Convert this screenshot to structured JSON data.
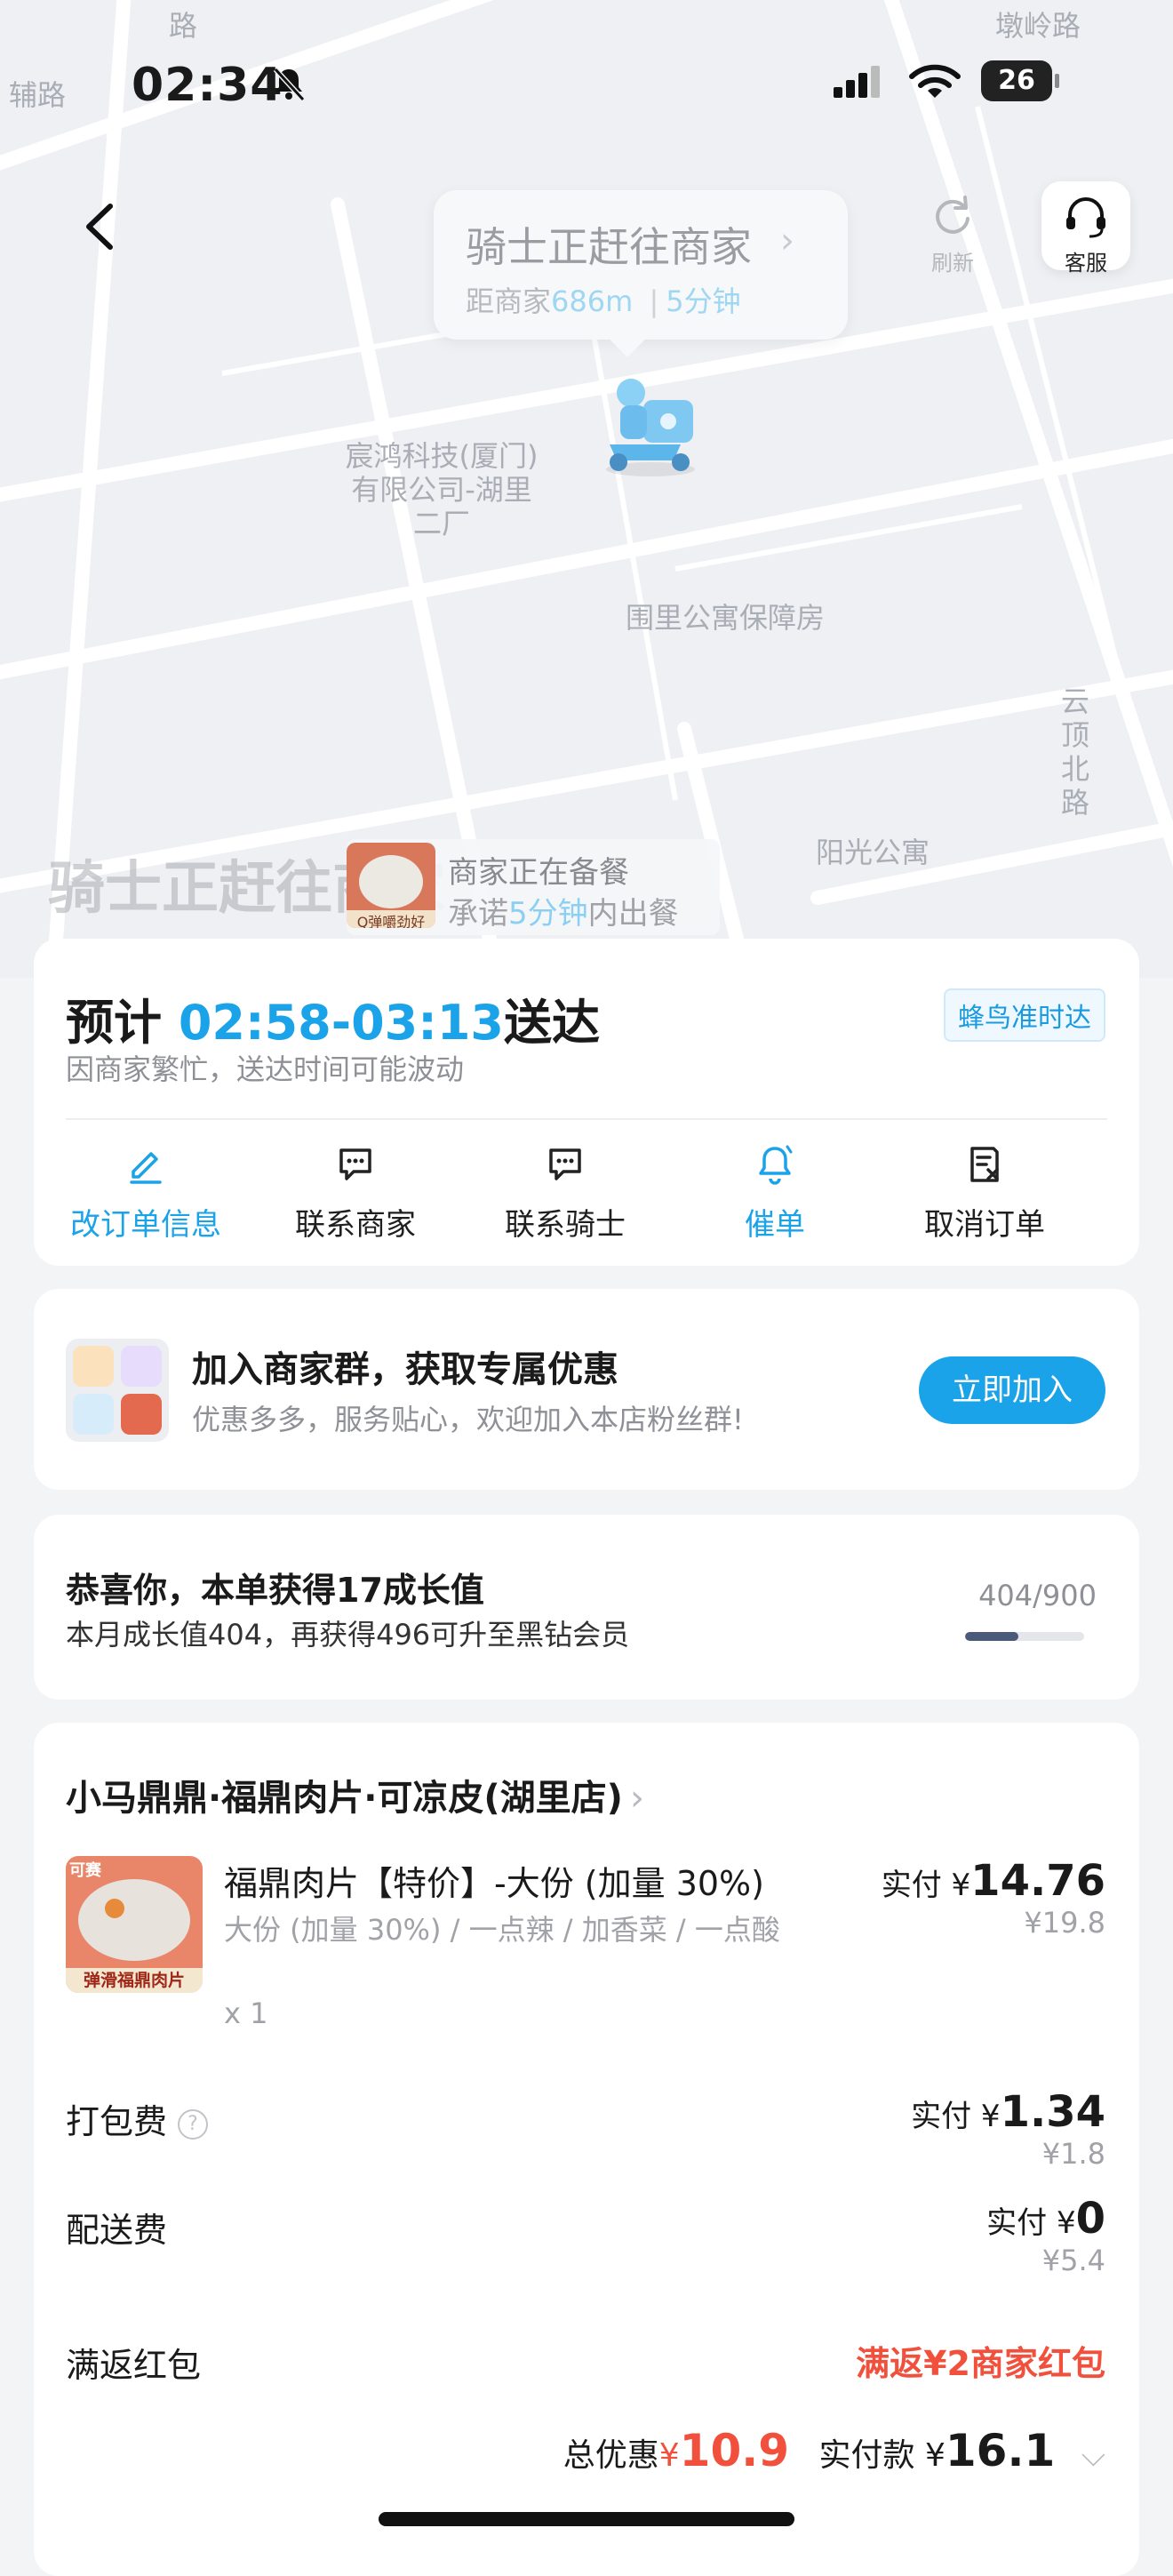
{
  "status_bar": {
    "time": "02:34",
    "battery": "26"
  },
  "map": {
    "labels": [
      "路",
      "辅路",
      "墩岭路",
      "宸鸿科技(厦门)有限公司-湖里二厂",
      "围里公寓保障房",
      "云顶北路",
      "阳光公寓"
    ],
    "watermark": "骑士正赶往商家"
  },
  "rider_status": {
    "title": "骑士正赶往商家",
    "distance_prefix": "距商家",
    "distance": "686m",
    "separator": "|",
    "eta": "5分钟"
  },
  "top_actions": {
    "refresh": "刷新",
    "service": "客服"
  },
  "merchant_tag": {
    "line1": "商家正在备餐",
    "line2_prefix": "承诺",
    "line2_highlight": "5分钟",
    "line2_suffix": "内出餐",
    "thumb_caption": "Q弹嚼劲好"
  },
  "eta_card": {
    "prefix": "预计",
    "range": "02:58-03:13",
    "suffix": "送达",
    "note": "因商家繁忙，送达时间可能波动",
    "badge": "蜂鸟准时达",
    "actions": [
      {
        "label": "改订单信息",
        "icon": "edit-icon",
        "highlight": true
      },
      {
        "label": "联系商家",
        "icon": "chat-icon",
        "highlight": false
      },
      {
        "label": "联系骑士",
        "icon": "chat-icon",
        "highlight": false
      },
      {
        "label": "催单",
        "icon": "bell-icon",
        "highlight": true
      },
      {
        "label": "取消订单",
        "icon": "cancel-order-icon",
        "highlight": false
      }
    ]
  },
  "group_card": {
    "title": "加入商家群，获取专属优惠",
    "subtitle": "优惠多多，服务贴心，欢迎加入本店粉丝群!",
    "button": "立即加入"
  },
  "growth_card": {
    "title": "恭喜你，本单获得17成长值",
    "subtitle": "本月成长值404，再获得496可升至黑钻会员",
    "progress_text": "404/900",
    "progress_fraction": 0.449
  },
  "order_card": {
    "store": "小马鼎鼎·福鼎肉片·可凉皮(湖里店)",
    "item": {
      "name": "福鼎肉片【特价】-大份 (加量 30%)",
      "spec": "大份 (加量 30%) / 一点辣 / 加香菜 / 一点酸",
      "qty": "x 1",
      "image_caption": "弹滑福鼎肉片",
      "image_tag": "可赛",
      "paid_label": "实付 ¥",
      "paid": "14.76",
      "original": "¥19.8"
    },
    "packing": {
      "label": "打包费",
      "paid_label": "实付 ¥",
      "paid": "1.34",
      "original": "¥1.8"
    },
    "delivery": {
      "label": "配送费",
      "paid_label": "实付 ¥",
      "paid": "0",
      "original": "¥5.4"
    },
    "red_packet": {
      "label": "满返红包",
      "value": "满返¥2商家红包"
    },
    "total": {
      "discount_label": "总优惠",
      "discount_symbol": "¥",
      "discount": "10.9",
      "paid_label": "实付款",
      "paid_symbol": "¥",
      "paid": "16.1"
    }
  },
  "colors": {
    "accent": "#1aa3e8",
    "red": "#f0503c",
    "map_bg": "#eef0f3"
  }
}
